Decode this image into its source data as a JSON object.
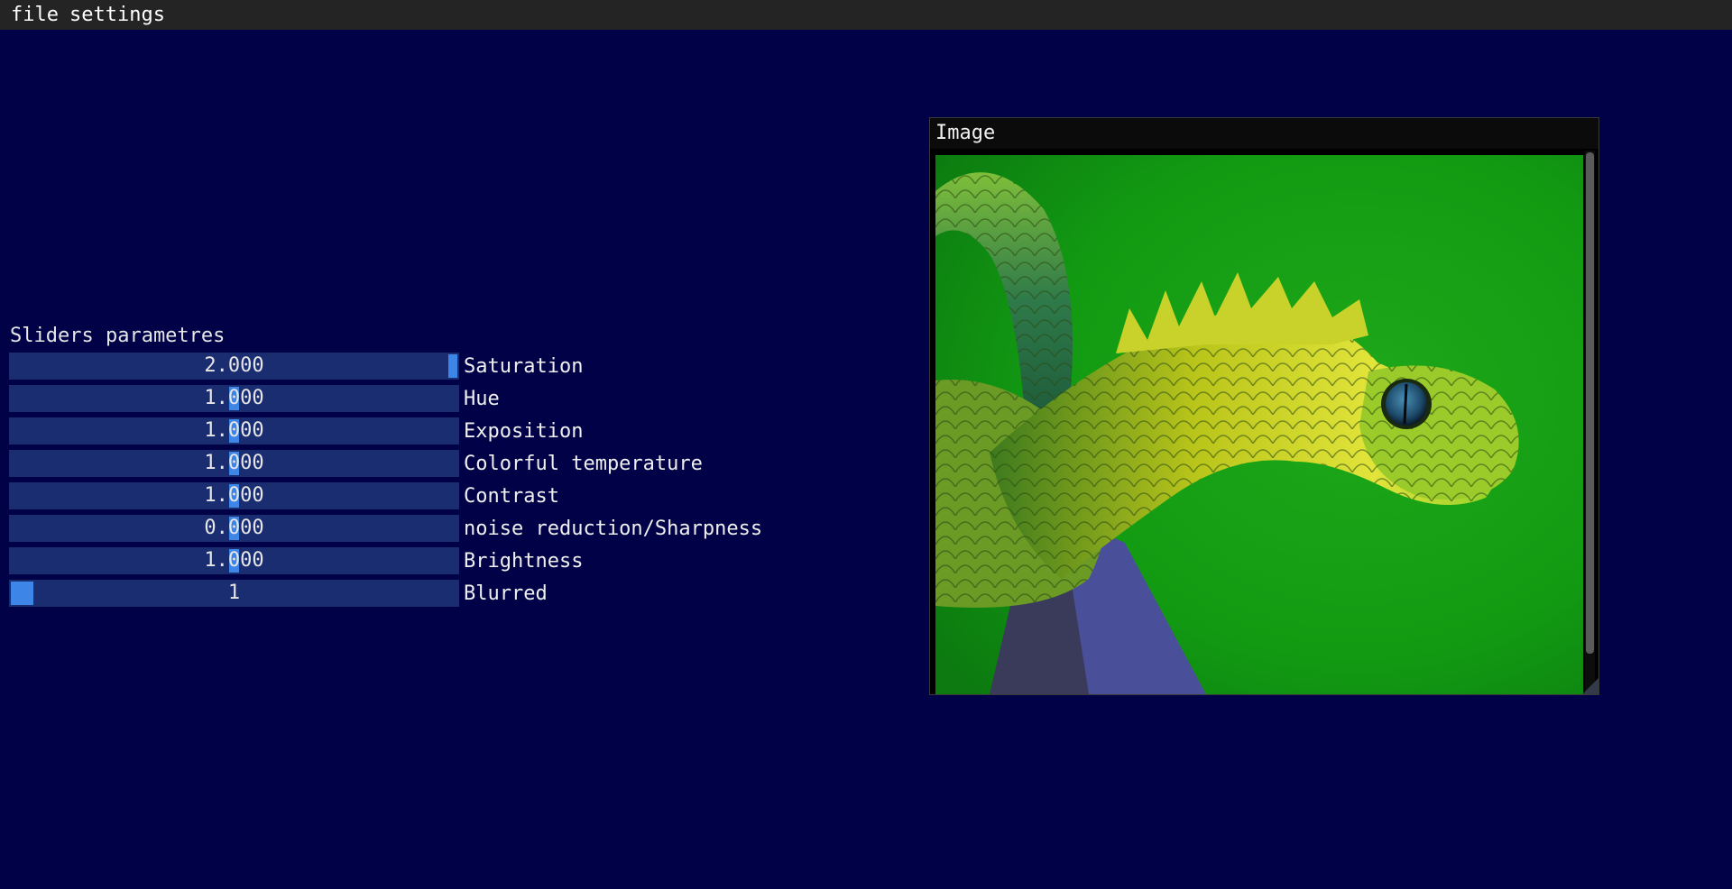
{
  "menu": {
    "items": [
      "file",
      "settings"
    ]
  },
  "panel": {
    "title": "Sliders parametres",
    "sliders": [
      {
        "label": "Saturation",
        "value": "2.000",
        "level": 1.0
      },
      {
        "label": "Hue",
        "value": "1.000",
        "level": 0.5
      },
      {
        "label": "Exposition",
        "value": "1.000",
        "level": 0.5
      },
      {
        "label": "Colorful temperature",
        "value": "1.000",
        "level": 0.5
      },
      {
        "label": "Contrast",
        "value": "1.000",
        "level": 0.5
      },
      {
        "label": "noise reduction/Sharpness",
        "value": "0.000",
        "level": 0.5
      },
      {
        "label": "Brightness",
        "value": "1.000",
        "level": 0.5
      },
      {
        "label": "Blurred",
        "value": "1",
        "level": 0.0
      }
    ]
  },
  "image_window": {
    "title": "Image",
    "picture": "green bush viper snake photo"
  },
  "colors": {
    "background": "#010147",
    "menubar": "#242424",
    "slider_track": "#1b2d71",
    "slider_grab": "#3d85e6"
  }
}
